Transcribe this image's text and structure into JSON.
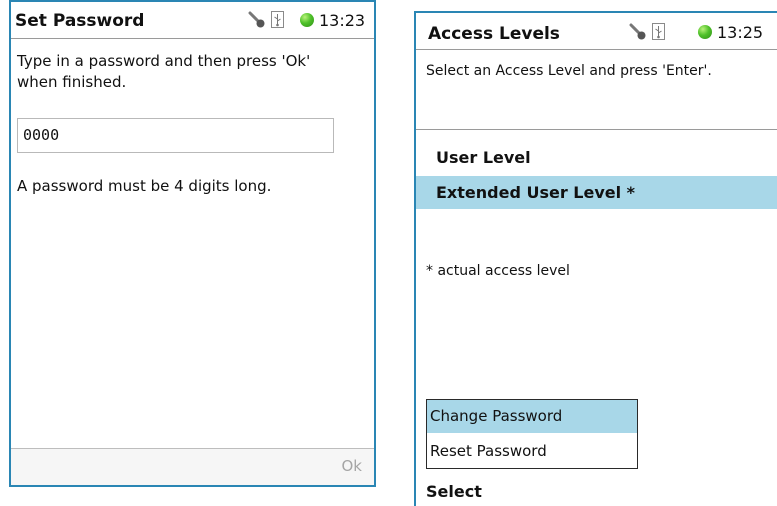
{
  "left": {
    "title": "Set Password",
    "time": "13:23",
    "instruction": "Type in a password and then press 'Ok' when finished.",
    "password_value": "0000",
    "hint": "A password must be 4 digits long.",
    "ok_label": "Ok"
  },
  "right": {
    "title": "Access Levels",
    "time": "13:25",
    "instruction": "Select an Access Level and press 'Enter'.",
    "levels": [
      {
        "label": "User Level",
        "selected": false
      },
      {
        "label": "Extended User Level *",
        "selected": true
      }
    ],
    "legend": "* actual access level",
    "menu": [
      {
        "label": "Change Password",
        "selected": true
      },
      {
        "label": "Reset Password",
        "selected": false
      }
    ],
    "softkey": "Select"
  },
  "icons": {
    "key": "key-icon",
    "usb": "usb-icon",
    "status": "status-led-icon"
  },
  "colors": {
    "frame": "#2a86b4",
    "selection": "#a8d7e8",
    "led": "#4fc12a"
  }
}
